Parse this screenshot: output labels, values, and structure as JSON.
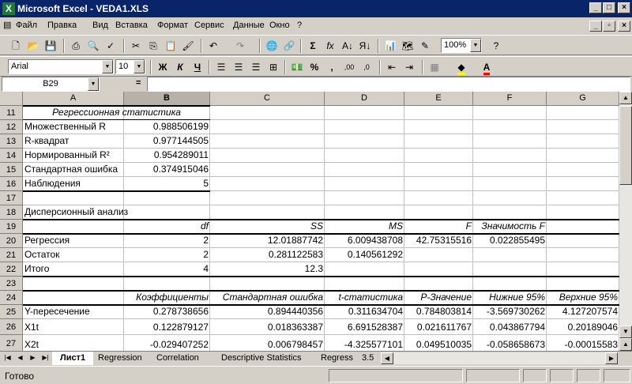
{
  "window": {
    "title": "Microsoft Excel - VEDA1.XLS"
  },
  "menu": [
    "Файл",
    "Правка",
    "Вид",
    "Вставка",
    "Формат",
    "Сервис",
    "Данные",
    "Окно",
    "?"
  ],
  "toolbar": {
    "zoom": "100%",
    "font": "Arial",
    "font_size": "10",
    "bold": "Ж",
    "italic": "К",
    "underline": "Ч",
    "percent": "%",
    "thousands": ",",
    "inc_dec": ",00",
    "dec_dec": ",0",
    "sum": "Σ",
    "fx": "fx"
  },
  "formula_bar": {
    "name_box": "B29",
    "equals": "=",
    "content": ""
  },
  "columns": [
    "A",
    "B",
    "C",
    "D",
    "E",
    "F",
    "G"
  ],
  "selected_column": "B",
  "rows": [
    {
      "n": "11",
      "cells": {
        "A": "Регрессионная статистика"
      }
    },
    {
      "n": "12",
      "cells": {
        "A": "Множественный R",
        "B": "0.988506199"
      }
    },
    {
      "n": "13",
      "cells": {
        "A": "R-квадрат",
        "B": "0.977144505"
      }
    },
    {
      "n": "14",
      "cells": {
        "A": "Нормированный R²",
        "B": "0.954289011"
      }
    },
    {
      "n": "15",
      "cells": {
        "A": "Стандартная ошибка",
        "B": "0.374915046"
      }
    },
    {
      "n": "16",
      "cells": {
        "A": "Наблюдения",
        "B": "5"
      }
    },
    {
      "n": "17",
      "cells": {}
    },
    {
      "n": "18",
      "cells": {
        "A": "Дисперсионный анализ"
      }
    },
    {
      "n": "19",
      "cells": {
        "B": "df",
        "C": "SS",
        "D": "MS",
        "E": "F",
        "F": "Значимость F"
      }
    },
    {
      "n": "20",
      "cells": {
        "A": "Регрессия",
        "B": "2",
        "C": "12.01887742",
        "D": "6.009438708",
        "E": "42.75315516",
        "F": "0.022855495"
      }
    },
    {
      "n": "21",
      "cells": {
        "A": "Остаток",
        "B": "2",
        "C": "0.281122583",
        "D": "0.140561292"
      }
    },
    {
      "n": "22",
      "cells": {
        "A": "Итого",
        "B": "4",
        "C": "12.3"
      }
    },
    {
      "n": "23",
      "cells": {}
    },
    {
      "n": "24",
      "cells": {
        "B": "Коэффициенты",
        "C": "Стандартная ошибка",
        "D": "t-статистика",
        "E": "P-Значение",
        "F": "Нижние 95%",
        "G": "Верхние 95%"
      }
    },
    {
      "n": "25",
      "cells": {
        "A": "Y-пересечение",
        "B": "0.278738656",
        "C": "0.894440356",
        "D": "0.311634704",
        "E": "0.784803814",
        "F": "-3.569730262",
        "G": "4.127207574"
      }
    },
    {
      "n": "26",
      "cells": {
        "A": "X1t",
        "B": "0.122879127",
        "C": "0.018363387",
        "D": "6.691528387",
        "E": "0.021611767",
        "F": "0.043867794",
        "G": "0.20189046"
      }
    },
    {
      "n": "27",
      "cells": {
        "A": "X2t",
        "B": "-0.029407252",
        "C": "0.006798457",
        "D": "-4.325577101",
        "E": "0.049510035",
        "F": "-0.058658673",
        "G": "-0.00015583"
      }
    }
  ],
  "sheet_tabs": [
    "Лист1",
    "Regression",
    "Correlation",
    "Descriptive Statistics",
    "Regress",
    "3.5"
  ],
  "active_tab": "Лист1",
  "status": "Готово",
  "colors": {
    "title_bar": "#0a246a",
    "face": "#d4d0c8",
    "grid_line": "#c0c0c0"
  }
}
